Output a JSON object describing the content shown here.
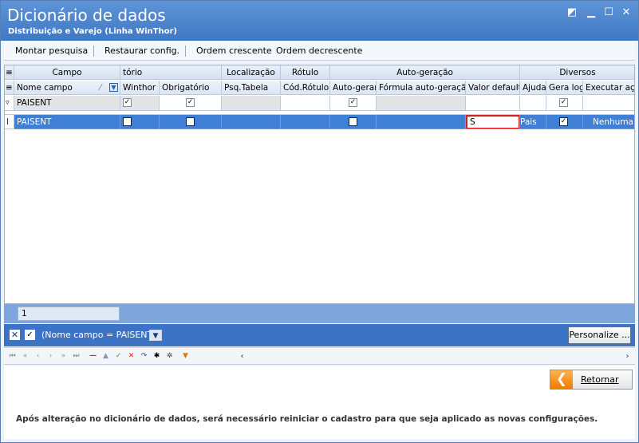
{
  "window": {
    "title": "Dicionário de dados",
    "subtitle": "Distribuição e Varejo (Linha WinThor)"
  },
  "toolbar": {
    "montar": "Montar pesquisa",
    "restaurar": "Restaurar config.",
    "crescente": "Ordem crescente",
    "decrescente": "Ordem decrescente"
  },
  "bands": {
    "campo": "Campo",
    "obrig": "tório",
    "localizacao": "Localização",
    "rotulo": "Rótulo",
    "autogeracao": "Auto-geração",
    "diversos": "Diversos"
  },
  "columns": {
    "nome": "Nome campo",
    "winthor": "Winthor",
    "obrigatorio": "Obrigatório",
    "pesq": "Psq.Tabela",
    "codrotulo": "Cód.Rótulo",
    "autogerar": "Auto-gerar",
    "formula": "Fórmula auto-geração",
    "valordefault": "Valor default",
    "ajuda": "Ajuda",
    "geralog": "Gera log",
    "executar": "Executar açã"
  },
  "filterrow": {
    "nome": "PAISENT",
    "winthor": true,
    "obrigatorio": true,
    "autogerar": true,
    "geralog": true
  },
  "row": {
    "indicator": "I",
    "nome": "PAISENT",
    "winthor": false,
    "obrigatorio": false,
    "autogerar": false,
    "valordefault": "S",
    "ajuda": "Pais",
    "geralog": true,
    "executar": "Nenhuma"
  },
  "summary": {
    "count": "1"
  },
  "filter": {
    "text": "(Nome campo = PAISENT)",
    "personalize": "Personalize ..."
  },
  "footer": {
    "retornar": "Retornar",
    "note": "Após alteração no dicionário de dados, será necessário reiniciar o cadastro para que seja aplicado as novas configurações."
  },
  "colors": {
    "accent": "#3f7fd6",
    "titlebar": "#4a84cf",
    "highlight": "#d62020"
  }
}
